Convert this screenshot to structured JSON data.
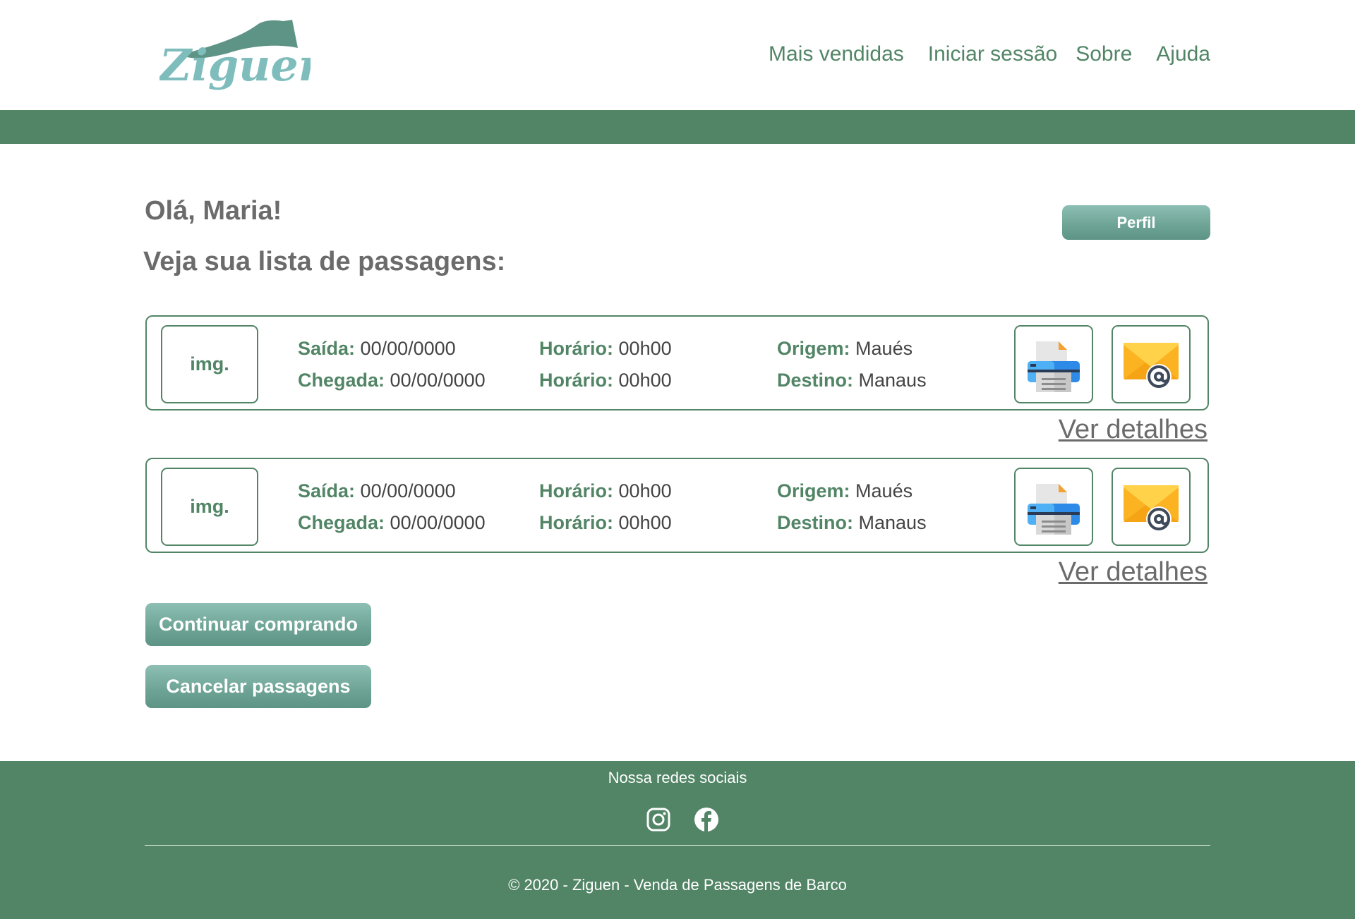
{
  "header": {
    "logo_text": "Ziguen",
    "nav": [
      "Mais vendidas",
      "Iniciar sessão",
      "Sobre",
      "Ajuda"
    ]
  },
  "main": {
    "greeting": "Olá, Maria!",
    "subtitle": "Veja sua lista de passagens:",
    "profile_button": "Perfil",
    "tickets": [
      {
        "image_placeholder": "img.",
        "departure_label": "Saída:",
        "departure_value": "00/00/0000",
        "arrival_label": "Chegada:",
        "arrival_value": "00/00/0000",
        "departure_time_label": "Horário:",
        "departure_time_value": "00h00",
        "arrival_time_label": "Horário:",
        "arrival_time_value": "00h00",
        "origin_label": "Origem:",
        "origin_value": "Maués",
        "destination_label": "Destino:",
        "destination_value": "Manaus",
        "details_link": "Ver detalhes"
      },
      {
        "image_placeholder": "img.",
        "departure_label": "Saída:",
        "departure_value": "00/00/0000",
        "arrival_label": "Chegada:",
        "arrival_value": "00/00/0000",
        "departure_time_label": "Horário:",
        "departure_time_value": "00h00",
        "arrival_time_label": "Horário:",
        "arrival_time_value": "00h00",
        "origin_label": "Origem:",
        "origin_value": "Maués",
        "destination_label": "Destino:",
        "destination_value": "Manaus",
        "details_link": "Ver detalhes"
      }
    ],
    "continue_button": "Continuar comprando",
    "cancel_button": "Cancelar passagens"
  },
  "footer": {
    "social_title": "Nossa redes sociais",
    "social_icons": [
      "instagram-icon",
      "facebook-icon"
    ],
    "copyright": "© 2020 - Ziguen - Venda de Passagens de Barco"
  },
  "colors": {
    "brand_green": "#528566",
    "button_teal": "#6fa597",
    "text_gray": "#6b6b6b"
  }
}
